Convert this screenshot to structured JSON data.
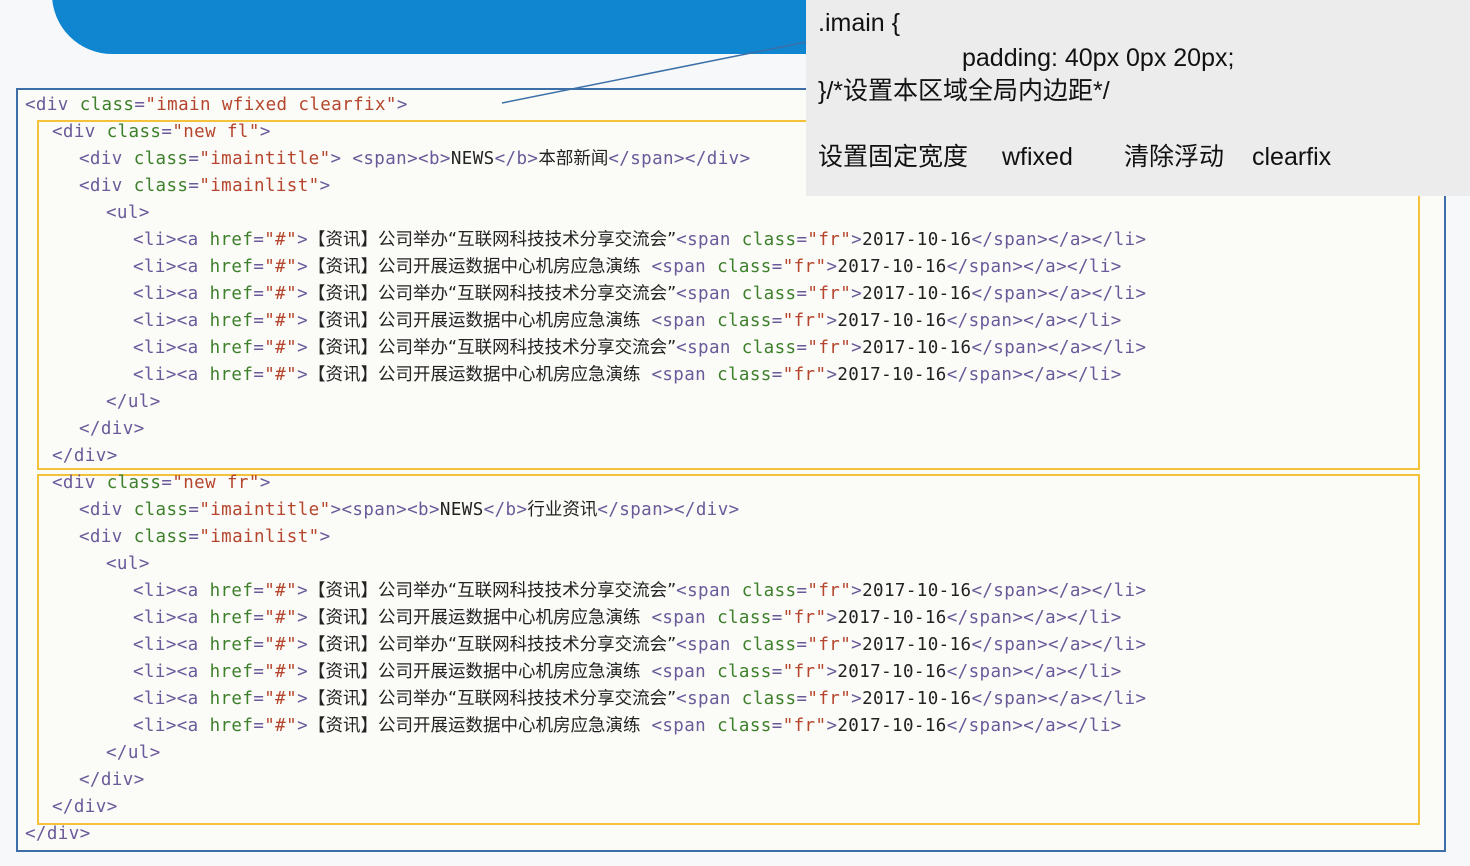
{
  "callout": {
    "line1": ".imain {",
    "line2": "padding: 40px 0px 20px;",
    "line3": "}/*设置本区域全局内边距*/",
    "label1": "设置固定宽度",
    "value1": "wfixed",
    "label2": "清除浮动",
    "value2": "clearfix"
  },
  "code": {
    "outer_open": "<div class=\"imain wfixed clearfix\">",
    "outer_close": "</div>",
    "blocks": [
      {
        "open": "<div class=\"new fl\">",
        "title": "<div class=\"imaintitle\"> <span><b>NEWS</b>本部新闻</span></div>",
        "list_open": "<div class=\"imainlist\">",
        "ul_open": "<ul>",
        "items": [
          "<li><a href=\"#\">【资讯】公司举办“互联网科技技术分享交流会”<span class=\"fr\">2017-10-16</span></a></li>",
          "<li><a href=\"#\">【资讯】公司开展运数据中心机房应急演练 <span class=\"fr\">2017-10-16</span></a></li>",
          "<li><a href=\"#\">【资讯】公司举办“互联网科技技术分享交流会”<span class=\"fr\">2017-10-16</span></a></li>",
          "<li><a href=\"#\">【资讯】公司开展运数据中心机房应急演练 <span class=\"fr\">2017-10-16</span></a></li>",
          "<li><a href=\"#\">【资讯】公司举办“互联网科技技术分享交流会”<span class=\"fr\">2017-10-16</span></a></li>",
          "<li><a href=\"#\">【资讯】公司开展运数据中心机房应急演练 <span class=\"fr\">2017-10-16</span></a></li>"
        ],
        "ul_close": "</ul>",
        "list_close": "</div>",
        "close": "</div>"
      },
      {
        "open": "<div class=\"new fr\">",
        "title": "<div class=\"imaintitle\"><span><b>NEWS</b>行业资讯</span></div>",
        "list_open": "<div class=\"imainlist\">",
        "ul_open": "<ul>",
        "items": [
          "<li><a href=\"#\">【资讯】公司举办“互联网科技技术分享交流会”<span class=\"fr\">2017-10-16</span></a></li>",
          "<li><a href=\"#\">【资讯】公司开展运数据中心机房应急演练 <span class=\"fr\">2017-10-16</span></a></li>",
          "<li><a href=\"#\">【资讯】公司举办“互联网科技技术分享交流会”<span class=\"fr\">2017-10-16</span></a></li>",
          "<li><a href=\"#\">【资讯】公司开展运数据中心机房应急演练 <span class=\"fr\">2017-10-16</span></a></li>",
          "<li><a href=\"#\">【资讯】公司举办“互联网科技技术分享交流会”<span class=\"fr\">2017-10-16</span></a></li>",
          "<li><a href=\"#\">【资讯】公司开展运数据中心机房应急演练 <span class=\"fr\">2017-10-16</span></a></li>"
        ],
        "ul_close": "</ul>",
        "list_close": "</div>",
        "close": "</div>"
      }
    ]
  },
  "colors": {
    "band": "#0f86cf",
    "frame": "#3c6fa8",
    "highlight": "#f3c23a",
    "tag": "#6a5a99",
    "attr": "#3d7f2a",
    "value": "#b5452c"
  }
}
